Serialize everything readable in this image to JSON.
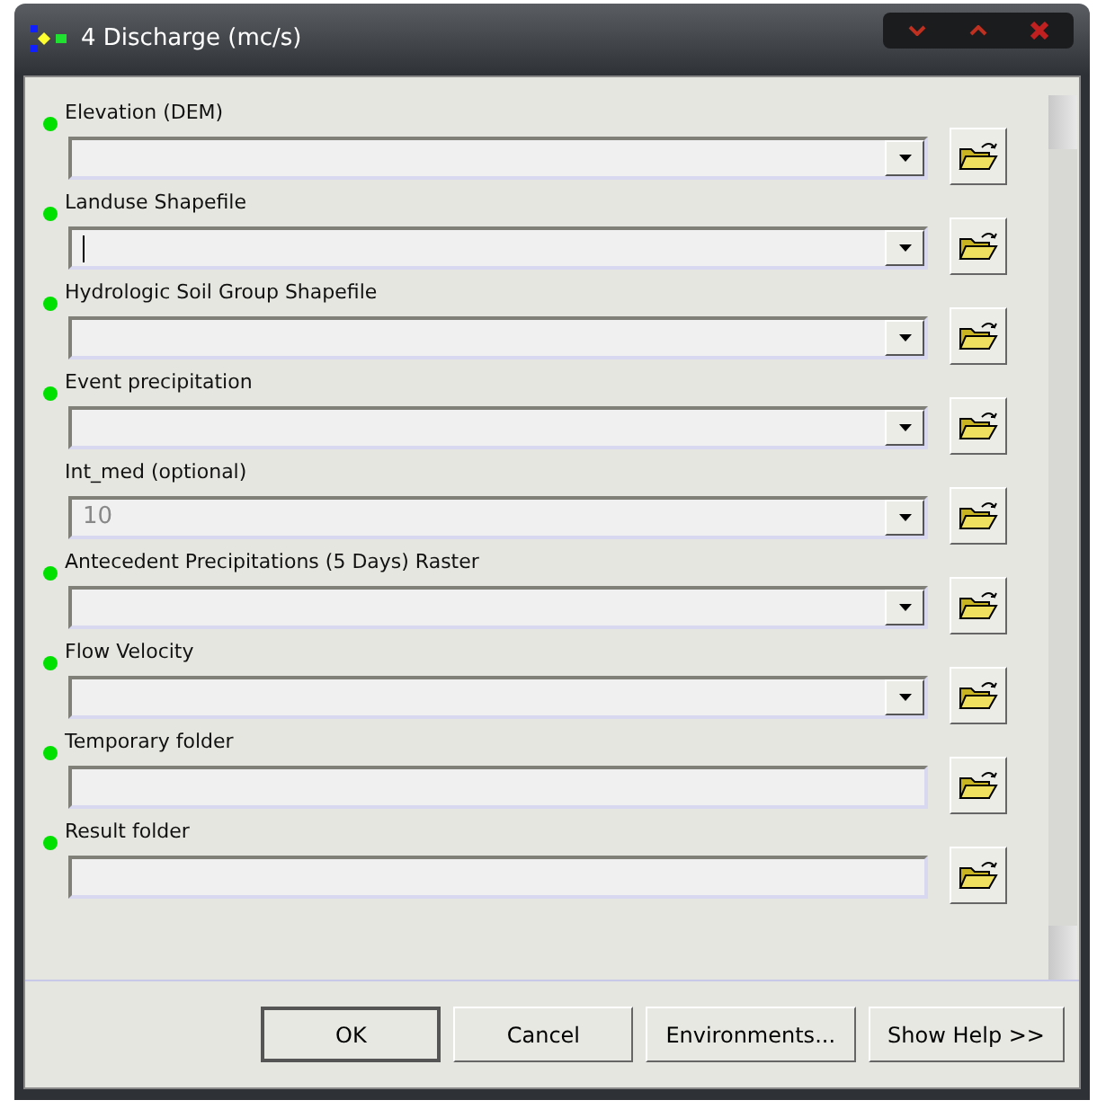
{
  "window": {
    "title": "4 Discharge (mc/s)"
  },
  "parameters": [
    {
      "label": "Elevation (DEM)",
      "required": true,
      "kind": "dropdown",
      "focused": false
    },
    {
      "label": "Landuse Shapefile",
      "required": true,
      "kind": "dropdown",
      "focused": true
    },
    {
      "label": "Hydrologic Soil Group Shapefile",
      "required": true,
      "kind": "dropdown",
      "focused": false
    },
    {
      "label": "Event precipitation",
      "required": true,
      "kind": "dropdown",
      "focused": false
    },
    {
      "label": "Int_med (optional)",
      "required": false,
      "kind": "dropdown",
      "value": "10",
      "focused": false
    },
    {
      "label": "Antecedent Precipitations (5 Days) Raster",
      "required": true,
      "kind": "dropdown",
      "focused": false
    },
    {
      "label": "Flow Velocity",
      "required": true,
      "kind": "dropdown",
      "focused": false
    },
    {
      "label": "Temporary folder",
      "required": true,
      "kind": "text",
      "focused": false
    },
    {
      "label": "Result folder",
      "required": true,
      "kind": "text",
      "focused": false
    }
  ],
  "buttons": [
    {
      "label": "OK",
      "default": true
    },
    {
      "label": "Cancel",
      "default": false
    },
    {
      "label": "Environments...",
      "default": false
    },
    {
      "label": "Show Help >>",
      "default": false
    }
  ]
}
